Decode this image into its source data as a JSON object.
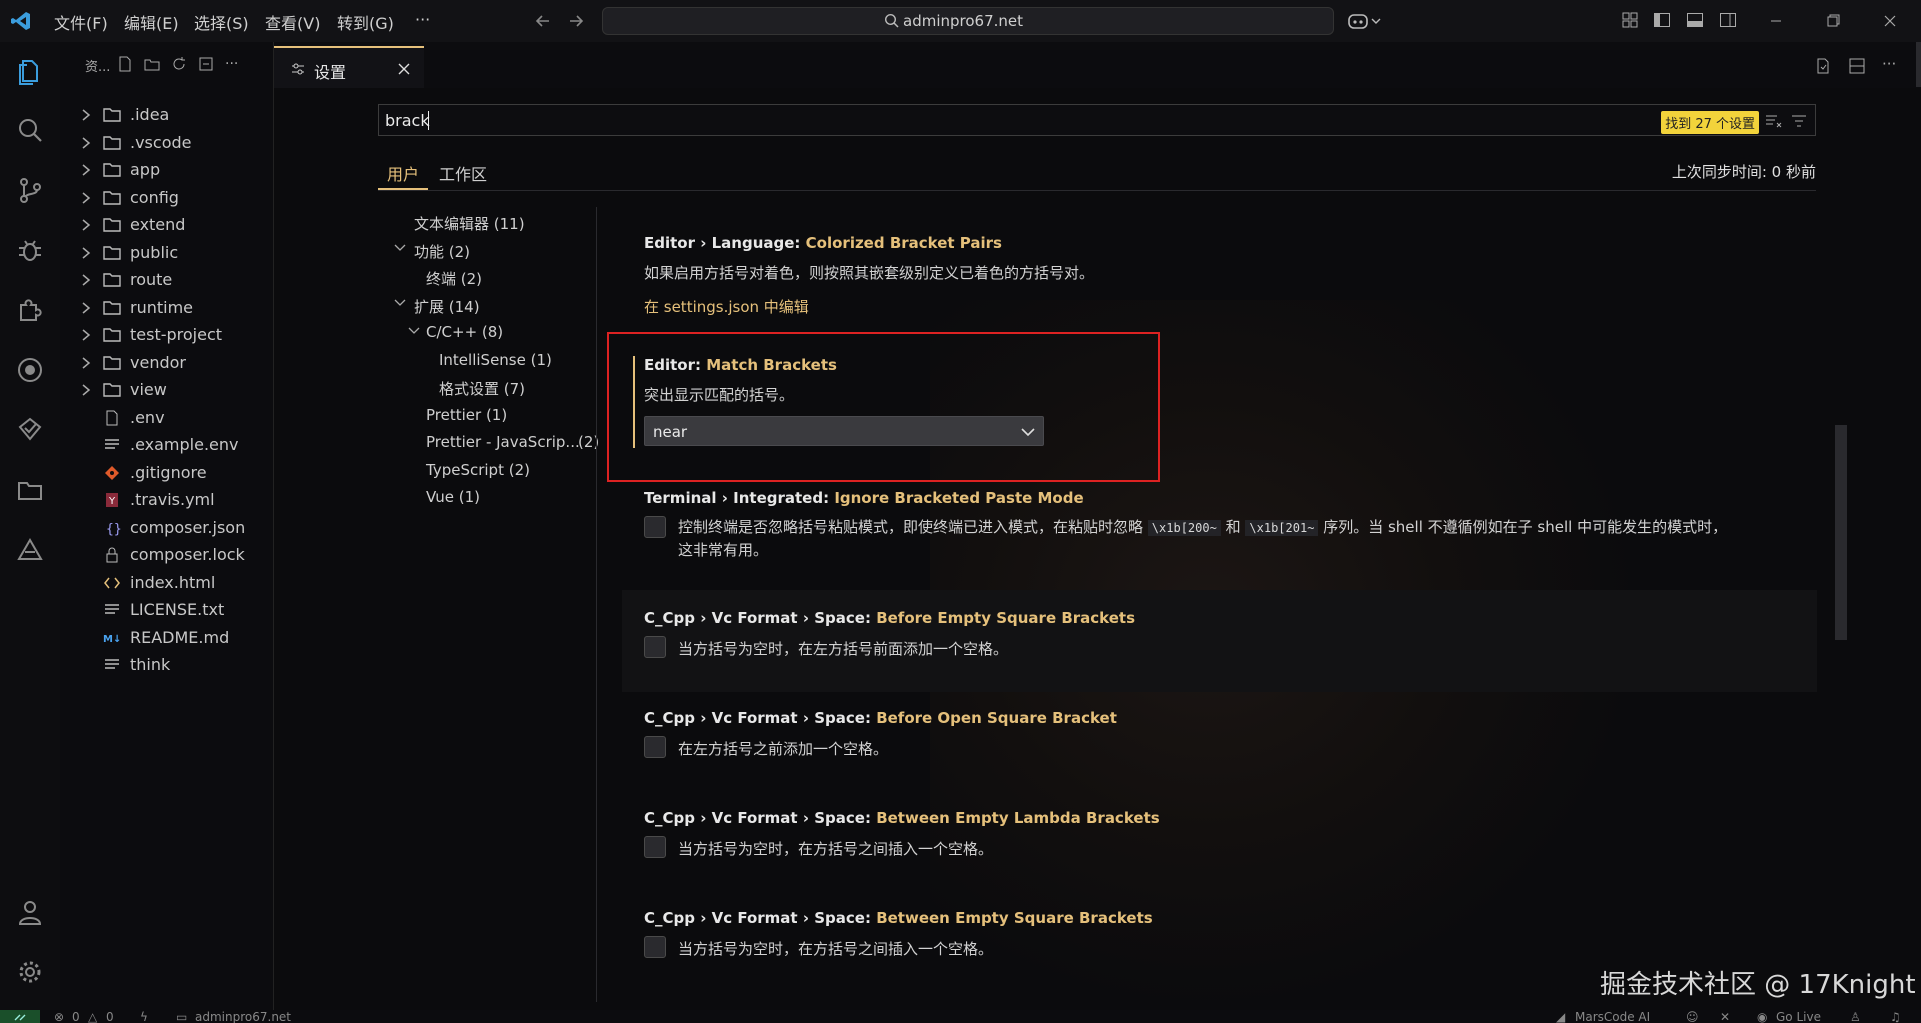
{
  "titlebar": {
    "menus": [
      "文件(F)",
      "编辑(E)",
      "选择(S)",
      "查看(V)",
      "转到(G)",
      "···"
    ],
    "search_text": "adminpro67.net"
  },
  "explorer": {
    "title": "资...",
    "items": [
      {
        "label": ".idea",
        "type": "folder"
      },
      {
        "label": ".vscode",
        "type": "folder"
      },
      {
        "label": "app",
        "type": "folder"
      },
      {
        "label": "config",
        "type": "folder"
      },
      {
        "label": "extend",
        "type": "folder"
      },
      {
        "label": "public",
        "type": "folder"
      },
      {
        "label": "route",
        "type": "folder"
      },
      {
        "label": "runtime",
        "type": "folder"
      },
      {
        "label": "test-project",
        "type": "folder"
      },
      {
        "label": "vendor",
        "type": "folder"
      },
      {
        "label": "view",
        "type": "folder"
      },
      {
        "label": ".env",
        "type": "file"
      },
      {
        "label": ".example.env",
        "type": "file"
      },
      {
        "label": ".gitignore",
        "type": "file"
      },
      {
        "label": ".travis.yml",
        "type": "file"
      },
      {
        "label": "composer.json",
        "type": "file"
      },
      {
        "label": "composer.lock",
        "type": "file"
      },
      {
        "label": "index.html",
        "type": "file"
      },
      {
        "label": "LICENSE.txt",
        "type": "file"
      },
      {
        "label": "README.md",
        "type": "file"
      },
      {
        "label": "think",
        "type": "file"
      }
    ]
  },
  "tab": {
    "label": "设置"
  },
  "settings": {
    "search_value": "brack",
    "found_badge": "找到 27 个设置",
    "scope_tabs": [
      "用户",
      "工作区"
    ],
    "sync_status": "上次同步时间: 0 秒前",
    "toc": [
      "文本编辑器 (11)",
      "功能 (2)",
      "终端 (2)",
      "扩展 (14)",
      "C/C++ (8)",
      "IntelliSense (1)",
      "格式设置 (7)",
      "Prettier (1)",
      "Prettier - JavaScrip...",
      "(2)",
      "TypeScript (2)",
      "Vue (1)"
    ],
    "items": [
      {
        "prefix": "Editor › Language: ",
        "key": "Colorized Bracket Pairs",
        "desc": "如果启用方括号对着色，则按照其嵌套级别定义已着色的方括号对。",
        "link": "在 settings.json 中编辑"
      },
      {
        "prefix": "Editor: ",
        "key": "Match Brackets",
        "desc": "突出显示匹配的括号。",
        "select_value": "near"
      },
      {
        "prefix": "Terminal › Integrated: ",
        "key": "Ignore Bracketed Paste Mode",
        "desc_a": "控制终端是否忽略括号粘贴模式，即使终端已进入模式，在粘贴时忽略",
        "code_a": "\\x1b[200~",
        "desc_b": "和",
        "code_b": "\\x1b[201~",
        "desc_c": "序列。当 shell 不遵循例如在子 shell 中可能发生的模式时，",
        "desc_d": "这非常有用。"
      },
      {
        "prefix": "C_Cpp › Vc Format › Space: ",
        "key": "Before Empty Square Brackets",
        "desc": "当方括号为空时，在左方括号前面添加一个空格。"
      },
      {
        "prefix": "C_Cpp › Vc Format › Space: ",
        "key": "Before Open Square Bracket",
        "desc": "在左方括号之前添加一个空格。"
      },
      {
        "prefix": "C_Cpp › Vc Format › Space: ",
        "key": "Between Empty Lambda Brackets",
        "desc": "当方括号为空时，在方括号之间插入一个空格。"
      },
      {
        "prefix": "C_Cpp › Vc Format › Space: ",
        "key": "Between Empty Square Brackets",
        "desc": "当方括号为空时，在方括号之间插入一个空格。"
      }
    ]
  },
  "watermark": "掘金技术社区 @ 17Knight",
  "statusbar": {
    "problems": "0",
    "warnings": "0",
    "remote": "adminpro67.net",
    "marscode": "MarsCode AI",
    "golive": "Go Live"
  },
  "colors": {
    "accent": "#e5c07b",
    "badge": "#f2d33b",
    "highlight": "#dd2222",
    "link": "#e5c07b"
  }
}
